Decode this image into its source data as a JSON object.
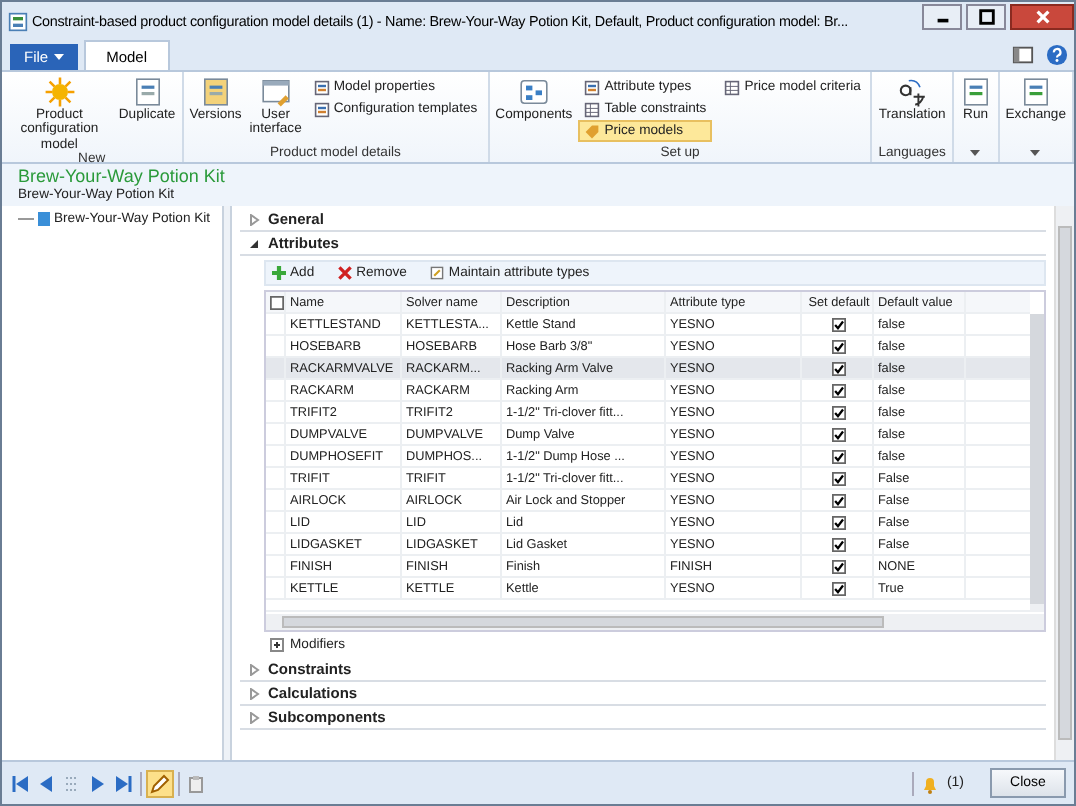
{
  "window": {
    "title": "Constraint-based product configuration model details (1) - Name: Brew-Your-Way Potion Kit, Default, Product configuration model: Br..."
  },
  "tabs": [
    {
      "label": "File",
      "kind": "file",
      "selected": false
    },
    {
      "label": "Model",
      "kind": "tab",
      "selected": true
    }
  ],
  "ribbon": [
    {
      "group": "New",
      "items": [
        {
          "label": "Product configuration model",
          "kind": "large"
        },
        {
          "label": "Duplicate",
          "kind": "large"
        }
      ]
    },
    {
      "group": "Product model details",
      "items": [
        {
          "label": "Versions",
          "kind": "large"
        },
        {
          "label": "User interface",
          "kind": "large"
        },
        {
          "label": "Model properties",
          "kind": "small",
          "highlighted": false
        },
        {
          "label": "Configuration templates",
          "kind": "small",
          "highlighted": false
        }
      ]
    },
    {
      "group": "Set up",
      "items": [
        {
          "label": "Components",
          "kind": "large"
        },
        {
          "label": "Attribute types",
          "kind": "small",
          "highlighted": false
        },
        {
          "label": "Table constraints",
          "kind": "small",
          "highlighted": false
        },
        {
          "label": "Price models",
          "kind": "small",
          "highlighted": true
        },
        {
          "label": "Price model criteria",
          "kind": "small",
          "highlighted": false
        }
      ]
    },
    {
      "group": "Languages",
      "items": [
        {
          "label": "Translation",
          "kind": "large"
        }
      ]
    },
    {
      "items": [
        {
          "label": "Run",
          "kind": "large"
        }
      ],
      "dropdown": true
    },
    {
      "items": [
        {
          "label": "Exchange",
          "kind": "large"
        }
      ],
      "dropdown": true
    }
  ],
  "header": {
    "title": "Brew-Your-Way Potion Kit",
    "subtitle": "Brew-Your-Way Potion Kit"
  },
  "tree": [
    {
      "label": "Brew-Your-Way Potion Kit"
    }
  ],
  "sections_top": [
    {
      "label": "General",
      "expanded": false
    },
    {
      "label": "Attributes",
      "expanded": true
    }
  ],
  "toolbar": [
    {
      "label": "Add",
      "kind": "add"
    },
    {
      "label": "Remove",
      "kind": "remove"
    },
    {
      "label": "Maintain attribute types",
      "kind": "maintain"
    }
  ],
  "table": {
    "all_selected": false,
    "columns": [
      "Name",
      "Solver name",
      "Description",
      "Attribute type",
      "Set default",
      "Default value"
    ],
    "rows": [
      {
        "name": "KETTLESTAND",
        "solver": "KETTLESTA...",
        "description": "Kettle Stand",
        "type": "YESNO",
        "set_default": true,
        "default": "false",
        "selected": false
      },
      {
        "name": "HOSEBARB",
        "solver": "HOSEBARB",
        "description": "Hose Barb 3/8\"",
        "type": "YESNO",
        "set_default": true,
        "default": "false",
        "selected": false
      },
      {
        "name": "RACKARMVALVE",
        "solver": "RACKARM...",
        "description": "Racking Arm Valve",
        "type": "YESNO",
        "set_default": true,
        "default": "false",
        "selected": true
      },
      {
        "name": "RACKARM",
        "solver": "RACKARM",
        "description": "Racking Arm",
        "type": "YESNO",
        "set_default": true,
        "default": "false",
        "selected": false
      },
      {
        "name": "TRIFIT2",
        "solver": "TRIFIT2",
        "description": "1-1/2\" Tri-clover fitt...",
        "type": "YESNO",
        "set_default": true,
        "default": "false",
        "selected": false
      },
      {
        "name": "DUMPVALVE",
        "solver": "DUMPVALVE",
        "description": "Dump Valve",
        "type": "YESNO",
        "set_default": true,
        "default": "false",
        "selected": false
      },
      {
        "name": "DUMPHOSEFIT",
        "solver": "DUMPHOS...",
        "description": "1-1/2\" Dump Hose ...",
        "type": "YESNO",
        "set_default": true,
        "default": "false",
        "selected": false
      },
      {
        "name": "TRIFIT",
        "solver": "TRIFIT",
        "description": "1-1/2\" Tri-clover fitt...",
        "type": "YESNO",
        "set_default": true,
        "default": "False",
        "selected": false
      },
      {
        "name": "AIRLOCK",
        "solver": "AIRLOCK",
        "description": "Air Lock and Stopper",
        "type": "YESNO",
        "set_default": true,
        "default": "False",
        "selected": false
      },
      {
        "name": "LID",
        "solver": "LID",
        "description": "Lid",
        "type": "YESNO",
        "set_default": true,
        "default": "False",
        "selected": false
      },
      {
        "name": "LIDGASKET",
        "solver": "LIDGASKET",
        "description": "Lid Gasket",
        "type": "YESNO",
        "set_default": true,
        "default": "False",
        "selected": false
      },
      {
        "name": "FINISH",
        "solver": "FINISH",
        "description": "Finish",
        "type": "FINISH",
        "set_default": true,
        "default": "NONE",
        "selected": false
      },
      {
        "name": "KETTLE",
        "solver": "KETTLE",
        "description": "Kettle",
        "type": "YESNO",
        "set_default": true,
        "default": "True",
        "selected": false
      }
    ]
  },
  "modifiers": {
    "label": "Modifiers",
    "expanded": false
  },
  "sections_bottom": [
    {
      "label": "Constraints",
      "expanded": false
    },
    {
      "label": "Calculations",
      "expanded": false
    },
    {
      "label": "Subcomponents",
      "expanded": false
    }
  ],
  "status_bar": {
    "notifications": "(1)",
    "close": "Close",
    "edit_mode": true
  }
}
